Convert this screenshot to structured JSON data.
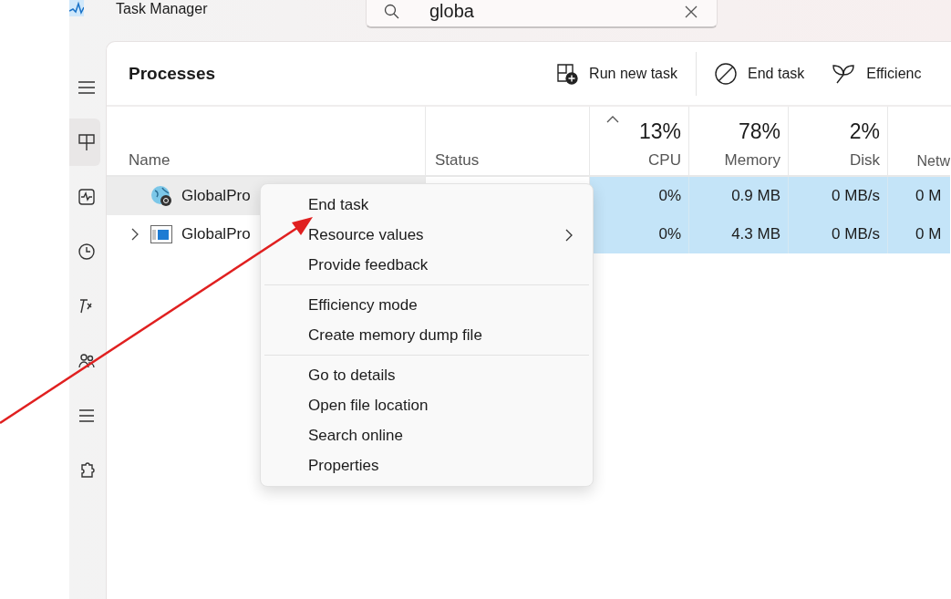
{
  "window": {
    "title": "Task Manager"
  },
  "search": {
    "value": "globa"
  },
  "sidebar": {
    "items": [
      {
        "kind": "menu",
        "selected": false
      },
      {
        "kind": "processes",
        "selected": true
      },
      {
        "kind": "performance",
        "selected": false
      },
      {
        "kind": "history",
        "selected": false
      },
      {
        "kind": "startup",
        "selected": false
      },
      {
        "kind": "users",
        "selected": false
      },
      {
        "kind": "details",
        "selected": false
      },
      {
        "kind": "services",
        "selected": false
      }
    ]
  },
  "page_title": "Processes",
  "toolbar": [
    {
      "kind": "run",
      "label": "Run new task"
    },
    {
      "kind": "end",
      "label": "End task"
    },
    {
      "kind": "leaf",
      "label": "Efficienc"
    }
  ],
  "table": {
    "columns": [
      {
        "label": "Name",
        "sorted": false
      },
      {
        "label": "Status",
        "sorted": false
      },
      {
        "label": "CPU",
        "value": "13%",
        "sorted": true
      },
      {
        "label": "Memory",
        "value": "78%",
        "sorted": false
      },
      {
        "label": "Disk",
        "value": "2%",
        "sorted": false
      },
      {
        "label": "Netw",
        "sorted": false
      }
    ],
    "rows": [
      {
        "kind": "service",
        "name": "GlobalPro",
        "expandable": false,
        "hovered": true,
        "cpu": "0%",
        "memory": "0.9 MB",
        "disk": "0 MB/s",
        "network": "0 M"
      },
      {
        "kind": "app",
        "name": "GlobalPro",
        "expandable": true,
        "hovered": false,
        "cpu": "0%",
        "memory": "4.3 MB",
        "disk": "0 MB/s",
        "network": "0 M"
      }
    ]
  },
  "context_menu": {
    "groups": [
      [
        {
          "label": "End task",
          "submenu": false
        },
        {
          "label": "Resource values",
          "submenu": true
        },
        {
          "label": "Provide feedback",
          "submenu": false
        }
      ],
      [
        {
          "label": "Efficiency mode",
          "submenu": false
        },
        {
          "label": "Create memory dump file",
          "submenu": false
        }
      ],
      [
        {
          "label": "Go to details",
          "submenu": false
        },
        {
          "label": "Open file location",
          "submenu": false
        },
        {
          "label": "Search online",
          "submenu": false
        },
        {
          "label": "Properties",
          "submenu": false
        }
      ]
    ]
  }
}
